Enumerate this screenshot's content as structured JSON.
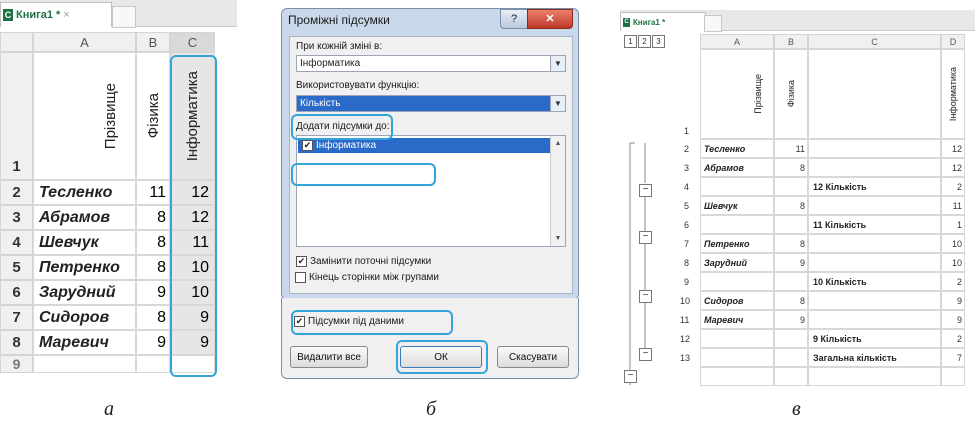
{
  "panel_a": {
    "tab_label": "Книга1 *",
    "tab_close": "×",
    "xl_glyph": "C",
    "columns": [
      "A",
      "B",
      "C"
    ],
    "headers": {
      "a": "Прізвище",
      "b": "Фізика",
      "c": "Інформатика"
    },
    "rows": [
      {
        "n": "2",
        "name": "Тесленко",
        "b": "11",
        "c": "12"
      },
      {
        "n": "3",
        "name": "Абрамов",
        "b": "8",
        "c": "12"
      },
      {
        "n": "4",
        "name": "Шевчук",
        "b": "8",
        "c": "11"
      },
      {
        "n": "5",
        "name": "Петренко",
        "b": "8",
        "c": "10"
      },
      {
        "n": "6",
        "name": "Зарудний",
        "b": "9",
        "c": "10"
      },
      {
        "n": "7",
        "name": "Сидоров",
        "b": "8",
        "c": "9"
      },
      {
        "n": "8",
        "name": "Маревич",
        "b": "9",
        "c": "9"
      }
    ],
    "row1": "1",
    "row9": "9",
    "caption": "а"
  },
  "panel_b": {
    "title": "Проміжні підсумки",
    "help_glyph": "?",
    "close_glyph": "✕",
    "label_change": "При кожній зміні в:",
    "change_value": "Інформатика",
    "label_func": "Використовувати функцію:",
    "func_value": "Кількість",
    "label_add": "Додати підсумки до:",
    "add_item": "Інформатика",
    "opt_replace": "Замінити поточні підсумки",
    "opt_pagebreak": "Кінець сторінки між групами",
    "opt_below": "Підсумки під даними",
    "btn_remove": "Видалити все",
    "btn_ok": "ОК",
    "btn_cancel": "Скасувати",
    "check": "✔",
    "caption": "б"
  },
  "panel_c": {
    "tab_label": "Книга1 *",
    "xl_glyph": "C",
    "levels": [
      "1",
      "2",
      "3"
    ],
    "columns": [
      "A",
      "B",
      "C",
      "D"
    ],
    "headers": {
      "b": "Прізвище",
      "c": "Фізика",
      "e": "Інформатика"
    },
    "minus": "−",
    "rows": [
      {
        "n": "1",
        "name": "",
        "b": "",
        "sub": "",
        "d": ""
      },
      {
        "n": "2",
        "name": "Тесленко",
        "b": "11",
        "sub": "",
        "d": "12"
      },
      {
        "n": "3",
        "name": "Абрамов",
        "b": "8",
        "sub": "",
        "d": "12"
      },
      {
        "n": "4",
        "name": "",
        "b": "",
        "sub": "12 Кількість",
        "d": "2"
      },
      {
        "n": "5",
        "name": "Шевчук",
        "b": "8",
        "sub": "",
        "d": "11"
      },
      {
        "n": "6",
        "name": "",
        "b": "",
        "sub": "11 Кількість",
        "d": "1"
      },
      {
        "n": "7",
        "name": "Петренко",
        "b": "8",
        "sub": "",
        "d": "10"
      },
      {
        "n": "8",
        "name": "Зарудний",
        "b": "9",
        "sub": "",
        "d": "10"
      },
      {
        "n": "9",
        "name": "",
        "b": "",
        "sub": "10 Кількість",
        "d": "2"
      },
      {
        "n": "10",
        "name": "Сидоров",
        "b": "8",
        "sub": "",
        "d": "9"
      },
      {
        "n": "11",
        "name": "Маревич",
        "b": "9",
        "sub": "",
        "d": "9"
      },
      {
        "n": "12",
        "name": "",
        "b": "",
        "sub": "9 Кількість",
        "d": "2"
      },
      {
        "n": "13",
        "name": "",
        "b": "",
        "sub": "Загальна кількість",
        "d": "7"
      }
    ],
    "caption": "в"
  }
}
